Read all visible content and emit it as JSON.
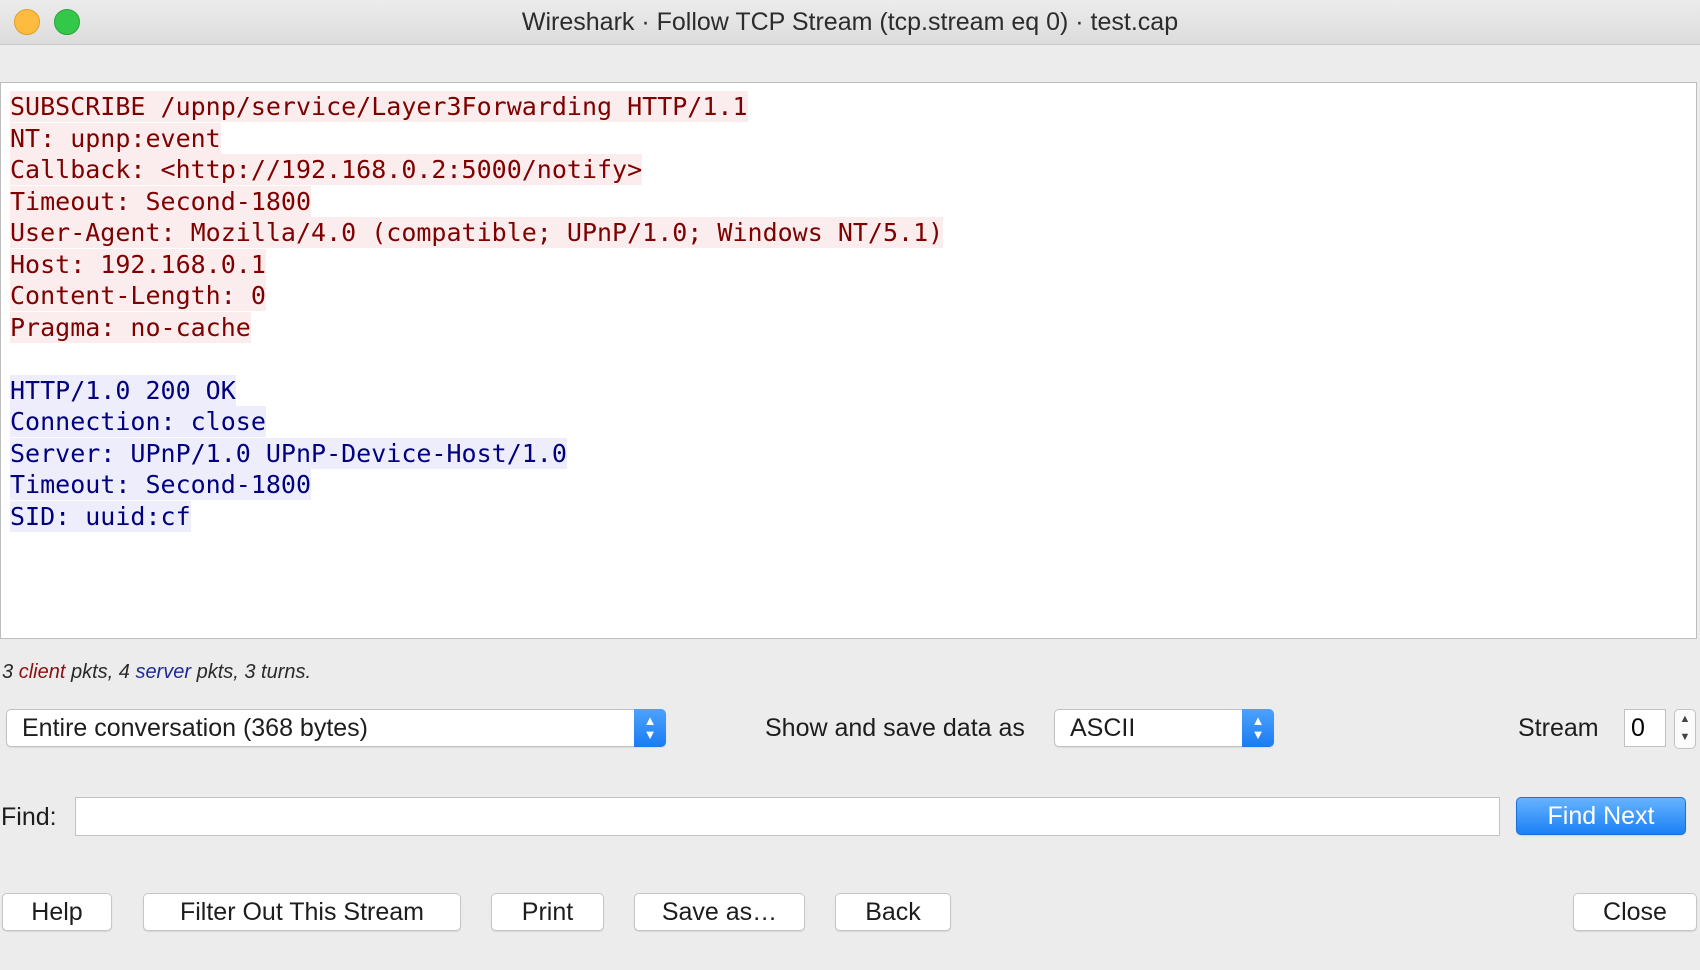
{
  "window": {
    "title": "Wireshark · Follow TCP Stream (tcp.stream eq 0) · test.cap"
  },
  "stream": {
    "client_lines": [
      "SUBSCRIBE /upnp/service/Layer3Forwarding HTTP/1.1",
      "NT: upnp:event",
      "Callback: <http://192.168.0.2:5000/notify>",
      "Timeout: Second-1800",
      "User-Agent: Mozilla/4.0 (compatible; UPnP/1.0; Windows NT/5.1)",
      "Host: 192.168.0.1",
      "Content-Length: 0",
      "Pragma: no-cache"
    ],
    "server_lines": [
      "HTTP/1.0 200 OK",
      "Connection: close",
      "Server: UPnP/1.0 UPnP-Device-Host/1.0",
      "Timeout: Second-1800",
      "SID: uuid:cf"
    ],
    "client_color": "#7f0000",
    "client_bg": "#fbeded",
    "server_color": "#00007f",
    "server_bg": "#ededfb"
  },
  "summary": {
    "client_count": "3",
    "client_word": "client",
    "pkts_sep": "pkts, 4",
    "server_word": "server",
    "tail": "pkts, 3 turns."
  },
  "controls": {
    "conversation_select": "Entire conversation (368 bytes)",
    "show_save_label": "Show and save data as",
    "format_select": "ASCII",
    "stream_label": "Stream",
    "stream_value": "0"
  },
  "find": {
    "label": "Find:",
    "value": "",
    "find_next": "Find Next"
  },
  "buttons": {
    "help": "Help",
    "filter_out": "Filter Out This Stream",
    "print": "Print",
    "save_as": "Save as…",
    "back": "Back",
    "close": "Close"
  },
  "colors": {
    "accent": "#1a80f5"
  }
}
